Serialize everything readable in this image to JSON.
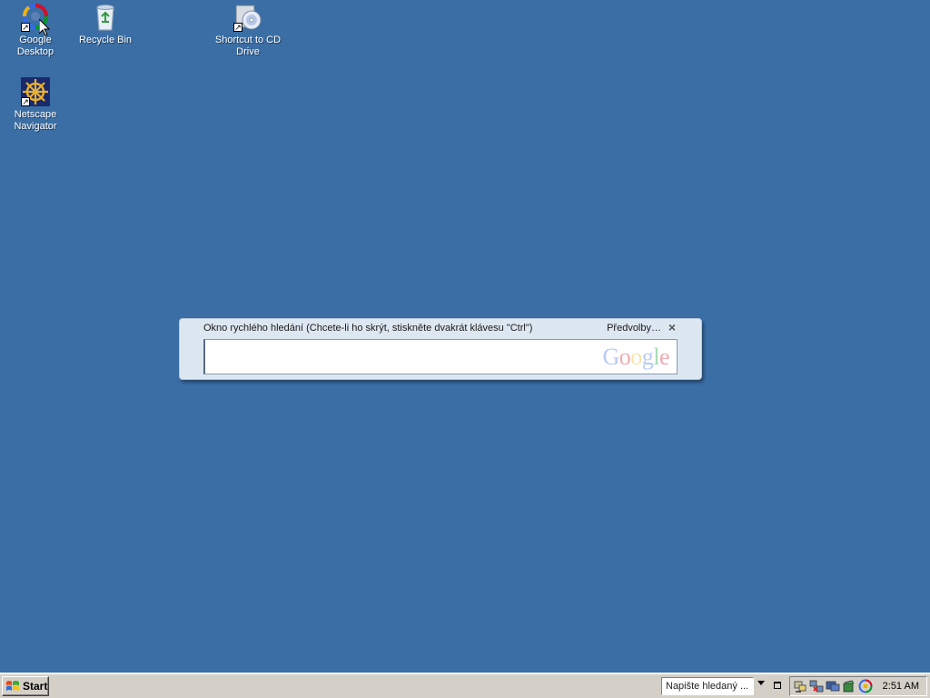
{
  "desktop": {
    "background_color": "#3a6ea5",
    "icons": [
      {
        "label": "Google Desktop",
        "icon": "google-desktop-icon",
        "shortcut": true
      },
      {
        "label": "Recycle Bin",
        "icon": "recycle-bin-icon",
        "shortcut": false
      },
      {
        "label": "Shortcut to CD Drive",
        "icon": "cd-drive-icon",
        "shortcut": true
      },
      {
        "label": "Netscape Navigator",
        "icon": "netscape-icon",
        "shortcut": true
      }
    ]
  },
  "quick_search": {
    "title": "Okno rychlého hledání (Chcete-li ho skrýt, stiskněte dvakrát klávesu \"Ctrl\")",
    "preferences_label": "Předvolby…",
    "close_glyph": "×",
    "input_value": "",
    "logo_text": "Google",
    "logo_colors": [
      "#3369e8",
      "#d50f25",
      "#eeb211",
      "#3369e8",
      "#009925",
      "#d50f25"
    ]
  },
  "taskbar": {
    "start_label": "Start",
    "deskbar_placeholder": "Napište hledaný ...",
    "tray_icons": [
      "network-icon",
      "network-status-icon",
      "display-icon",
      "recycle-tray-icon",
      "google-desktop-tray-icon"
    ],
    "clock": "2:51 AM"
  }
}
